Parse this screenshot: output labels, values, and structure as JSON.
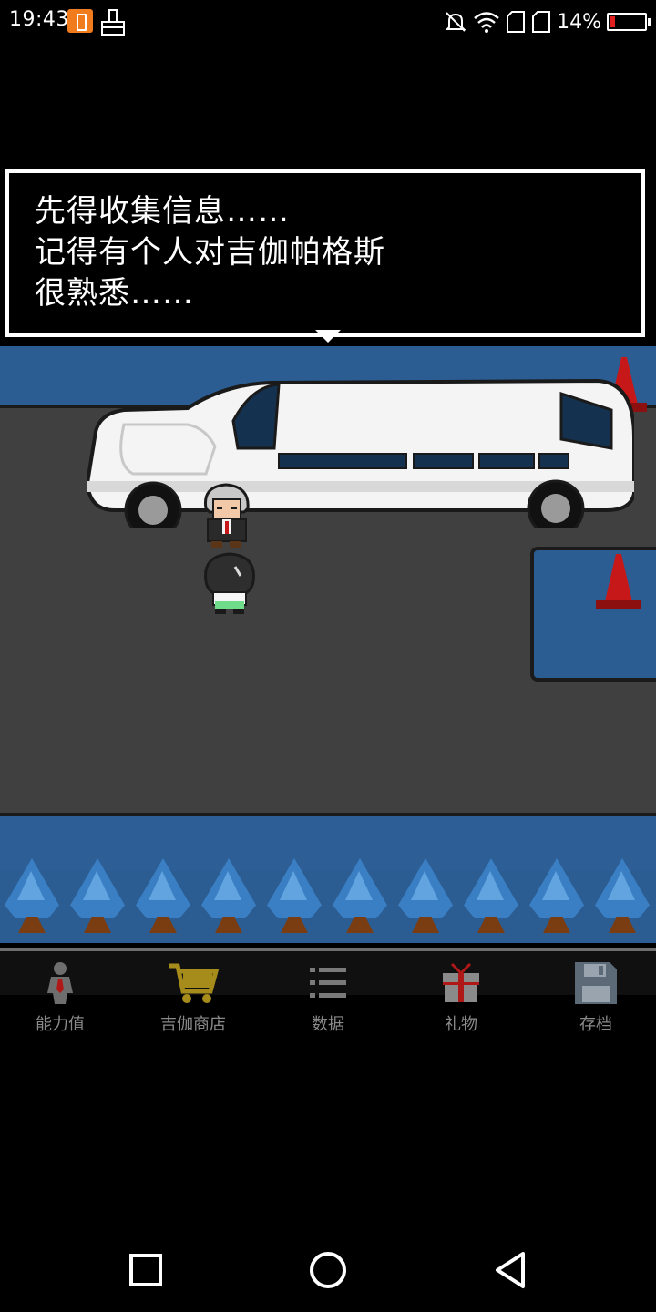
{
  "status_bar": {
    "time": "19:43",
    "battery_percent": "14%",
    "battery_level": 0.14,
    "icons": [
      "battery-saver-icon",
      "brush-icon",
      "bell-muted-icon",
      "wifi-icon",
      "sim1-icon",
      "sim2-icon",
      "battery-icon"
    ]
  },
  "dialog": {
    "text": "先得收集信息……\n记得有个人对吉伽帕格斯\n很熟悉……"
  },
  "menu": {
    "items": [
      {
        "label": "能力值",
        "icon": "person-stats-icon"
      },
      {
        "label": "吉伽商店",
        "icon": "shopping-cart-icon"
      },
      {
        "label": "数据",
        "icon": "list-icon"
      },
      {
        "label": "礼物",
        "icon": "gift-icon"
      },
      {
        "label": "存档",
        "icon": "save-disk-icon"
      }
    ]
  },
  "nav": {
    "icons": [
      "recent-apps-icon",
      "home-icon",
      "back-icon"
    ]
  },
  "colors": {
    "sidewalk": "#2c5d92",
    "asphalt": "#404040",
    "cone": "#c61818",
    "tree": "#3a7fc4",
    "menu_label": "#8a8a8a",
    "battery_low": "#e02020",
    "battery_saver": "#f07c1e"
  }
}
